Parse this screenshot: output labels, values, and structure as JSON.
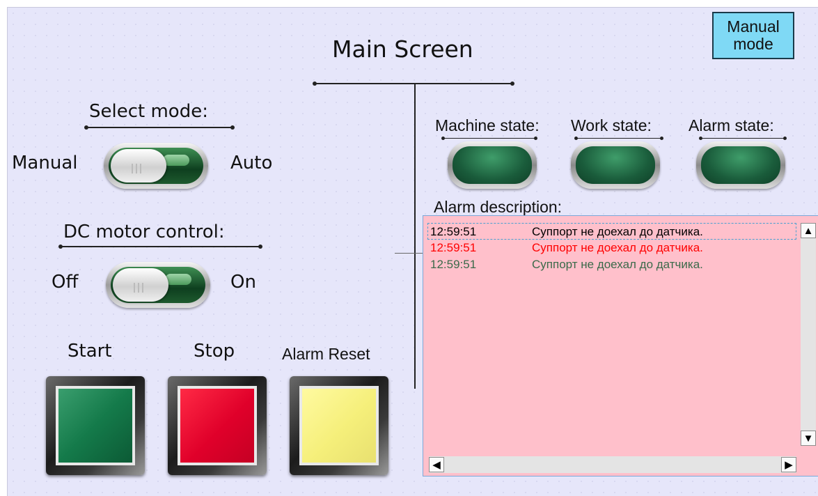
{
  "header": {
    "title": "Main Screen"
  },
  "mode_button": {
    "line1": "Manual",
    "line2": "mode"
  },
  "select_mode": {
    "label": "Select mode:",
    "left": "Manual",
    "right": "Auto"
  },
  "motor": {
    "label": "DC motor control:",
    "left": "Off",
    "right": "On"
  },
  "buttons": {
    "start": "Start",
    "stop": "Stop",
    "reset": "Alarm Reset"
  },
  "states": {
    "machine": "Machine state:",
    "work": "Work state:",
    "alarm": "Alarm state:"
  },
  "alarm": {
    "label": "Alarm description:",
    "rows": [
      {
        "time": "12:59:51",
        "msg": "Суппорт не доехал до датчика.",
        "color": "#000000"
      },
      {
        "time": "12:59:51",
        "msg": "Суппорт не доехал до датчика.",
        "color": "#ff0000"
      },
      {
        "time": "12:59:51",
        "msg": "Суппорт не доехал до датчика.",
        "color": "#3a6a4a"
      }
    ]
  },
  "colors": {
    "background": "#e6e6fa",
    "mode_button": "#7fd9f5",
    "alarm_panel": "#ffc0cb",
    "lamp": "#1f6b45",
    "start": "#147a4a",
    "stop": "#e0002a",
    "reset": "#f5ef7a"
  },
  "toggles": {
    "select_mode_on": true,
    "motor_on": true
  }
}
